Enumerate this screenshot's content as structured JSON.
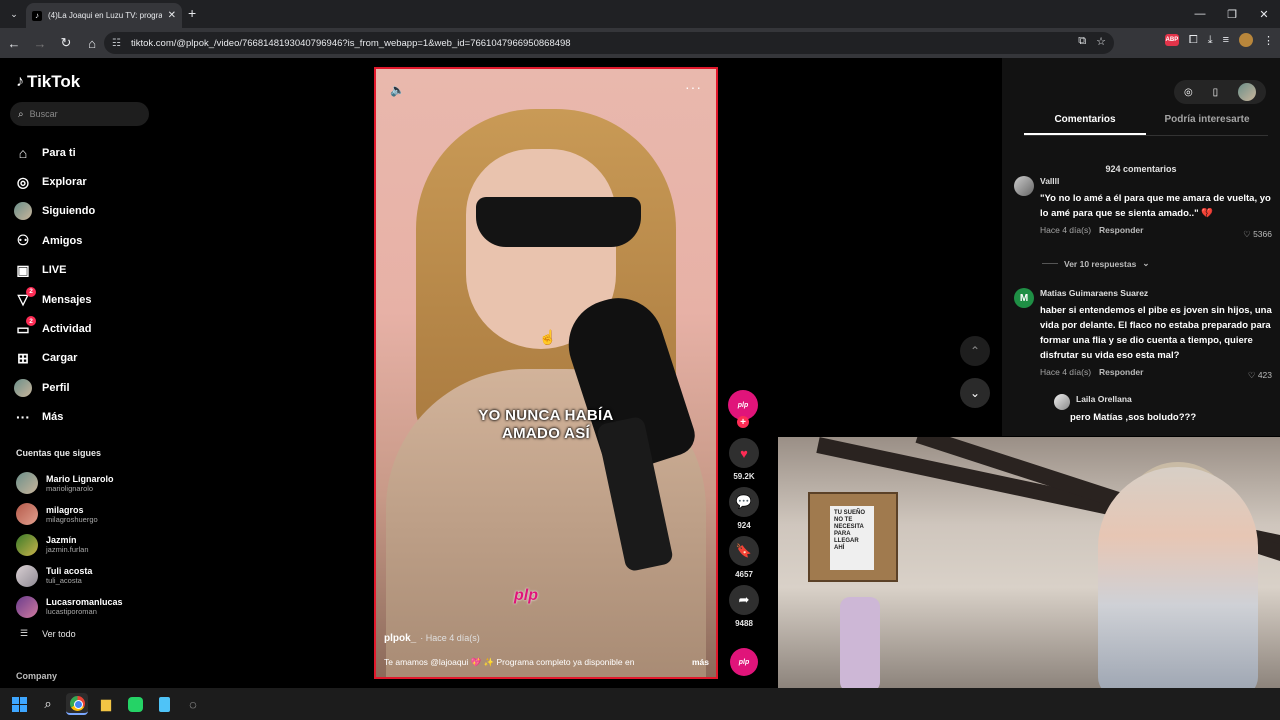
{
  "browser": {
    "tab_title": "(4)La Joaqui en Luzu TV: progra",
    "url": "tiktok.com/@plpok_/video/7668148193040796946?is_from_webapp=1&web_id=7661047966950868498"
  },
  "sidebar": {
    "logo": "TikTok",
    "search_placeholder": "Buscar",
    "nav": [
      {
        "label": "Para ti",
        "icon": "home-icon"
      },
      {
        "label": "Explorar",
        "icon": "compass-icon"
      },
      {
        "label": "Siguiendo",
        "icon": "avatar-icon"
      },
      {
        "label": "Amigos",
        "icon": "friends-icon"
      },
      {
        "label": "LIVE",
        "icon": "live-icon"
      },
      {
        "label": "Mensajes",
        "icon": "messages-icon",
        "badge": "2"
      },
      {
        "label": "Actividad",
        "icon": "activity-icon",
        "badge": "2"
      },
      {
        "label": "Cargar",
        "icon": "upload-icon"
      },
      {
        "label": "Perfil",
        "icon": "profile-icon"
      },
      {
        "label": "Más",
        "icon": "more-icon"
      }
    ],
    "following_header": "Cuentas que sigues",
    "following": [
      {
        "name": "Mario Lignarolo",
        "handle": "mariolignarolo"
      },
      {
        "name": "milagros",
        "handle": "milagroshuergo"
      },
      {
        "name": "Jazmín",
        "handle": "jazmin.furlan"
      },
      {
        "name": "Tuli acosta",
        "handle": "tuli_acosta"
      },
      {
        "name": "Lucasromanlucas",
        "handle": "lucastiporoman"
      }
    ],
    "see_all": "Ver todo",
    "company": "Company"
  },
  "video": {
    "caption": [
      "YO NUNCA HABÍA",
      "AMADO ASÍ"
    ],
    "watermark": "plp",
    "author": "plpok_",
    "posted": "· Hace 4 día(s)",
    "description": "Te amamos @lajoaqui 💖 ✨ Programa completo ya disponible en",
    "more": "más"
  },
  "actions": {
    "likes": "59.2K",
    "comments": "924",
    "saves": "4657",
    "shares": "9488",
    "profile_tag": "plp"
  },
  "comments_panel": {
    "tabs": [
      "Comentarios",
      "Podría interesarte"
    ],
    "count": "924 comentarios",
    "comments": [
      {
        "user": "Vallll",
        "text": "\"Yo no lo amé a él para que me amara de vuelta, yo lo amé para que se sienta amado..\" 💔",
        "time": "Hace 4 día(s)",
        "reply": "Responder",
        "likes": "5366"
      },
      {
        "user": "Matias Guimaraens Suarez",
        "initial": "M",
        "text": "haber si entendemos el pibe es joven sin hijos, una vida por delante. El flaco no estaba preparado para formar una flia y se dio cuenta a tiempo, quiere disfrutar su vida eso esta mal?",
        "time": "Hace 4 día(s)",
        "reply": "Responder",
        "likes": "423"
      }
    ],
    "view_replies": "Ver 10 respuestas",
    "reply": {
      "user": "Laila Orellana",
      "text": "pero Matías ,sos boludo???"
    }
  },
  "webcam": {
    "poster_text": "TU SUEÑO NO TE NECESITA PARA LLEGAR AHÍ"
  },
  "colors": {
    "accent": "#fe2c55",
    "brand_pink": "#e0147a"
  }
}
